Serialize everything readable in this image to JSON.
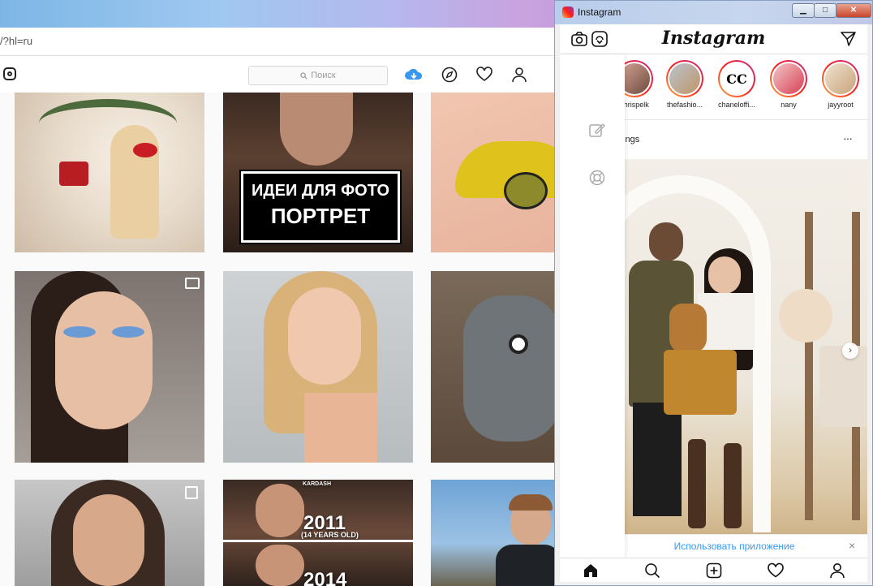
{
  "background_browser": {
    "url": "/?hl=ru",
    "search": {
      "placeholder": "Поиск"
    },
    "grid": {
      "portrait_card": {
        "line1": "ИДЕИ ДЛЯ ФОТО",
        "line2": "ПОРТРЕТ"
      },
      "kylie_card": {
        "year_top": "2011",
        "year_sub": "(14 YEARS OLD)",
        "year_bottom": "2014",
        "brand": "KARDASH"
      }
    }
  },
  "app_window": {
    "title": "Instagram",
    "buttons": {
      "minimize": "▁",
      "maximize": "□",
      "close": "✕"
    },
    "header": {
      "logo": "Instagram"
    },
    "stories": [
      {
        "name": "chrispelk"
      },
      {
        "name": "thefashio..."
      },
      {
        "name": "chaneloffi..."
      },
      {
        "name": "nany"
      },
      {
        "name": "jayyroot"
      }
    ],
    "chanel_logo": "CC",
    "post": {
      "username_partial": "rlings",
      "more": "···"
    },
    "banner": {
      "text": "Использовать приложение",
      "close": "×"
    },
    "colors": {
      "accent": "#3897f0",
      "story_ring": "#e1306c"
    }
  }
}
